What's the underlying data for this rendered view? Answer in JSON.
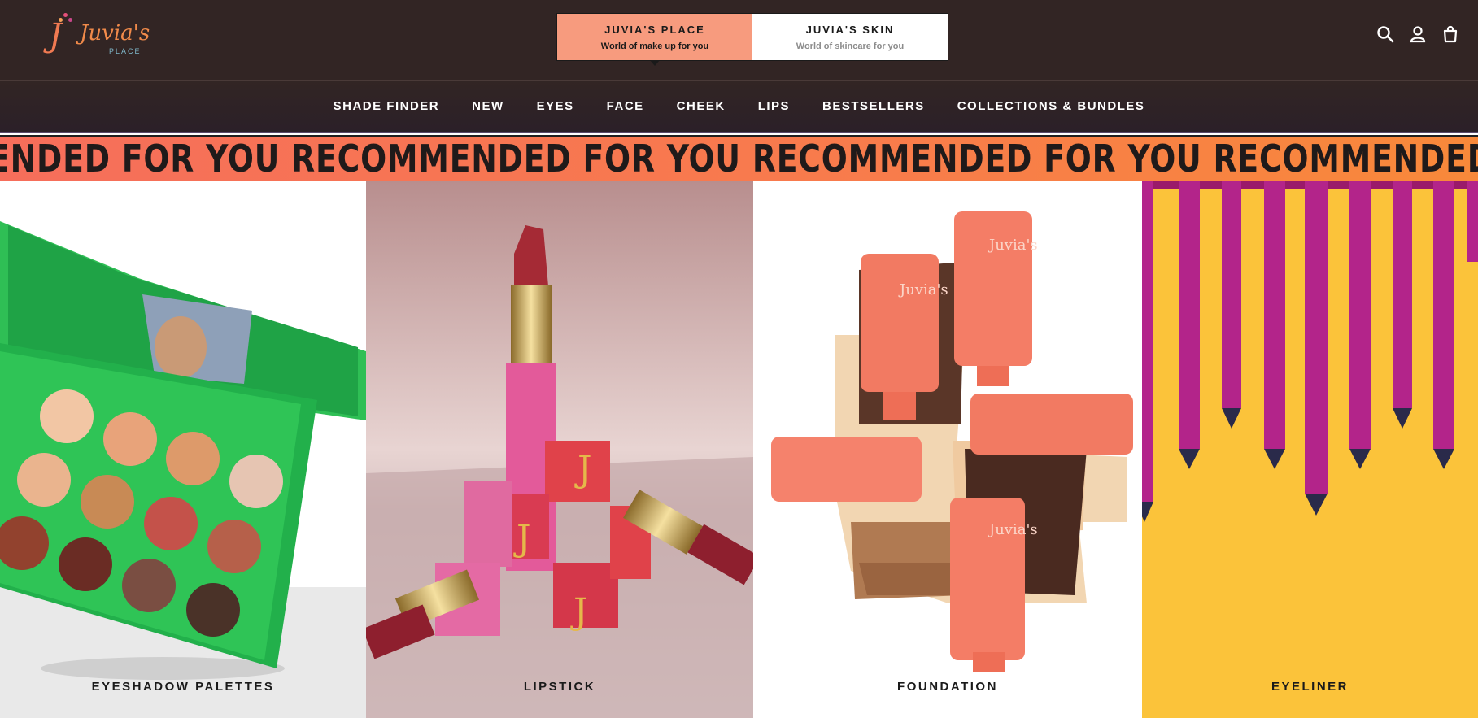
{
  "brand": {
    "logo_text": "Juvia's",
    "logo_sub": "PLACE"
  },
  "switcher": [
    {
      "name": "JUVIA'S PLACE",
      "tagline": "World of make up for you",
      "active": true
    },
    {
      "name": "JUVIA'S SKIN",
      "tagline": "World of skincare for you",
      "active": false
    }
  ],
  "utility_icons": [
    "search-icon",
    "account-icon",
    "bag-icon"
  ],
  "nav": [
    "SHADE FINDER",
    "NEW",
    "EYES",
    "FACE",
    "CHEEK",
    "LIPS",
    "BESTSELLERS",
    "COLLECTIONS & BUNDLES"
  ],
  "marquee": "ENDED FOR YOU RECOMMENDED FOR YOU RECOMMENDED FOR YOU RECOMMENDED FOR YOU",
  "categories": [
    {
      "label": "EYESHADOW PALETTES"
    },
    {
      "label": "LIPSTICK"
    },
    {
      "label": "FOUNDATION"
    },
    {
      "label": "EYELINER"
    }
  ],
  "colors": {
    "header_bg": "#322524",
    "active_tab": "#f79b7e",
    "marquee_start": "#f66e5b",
    "marquee_end": "#f8893a"
  }
}
